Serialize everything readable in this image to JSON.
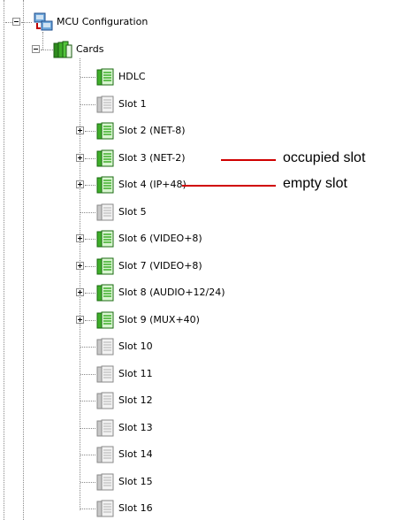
{
  "tree": {
    "root": {
      "label": "MCU Configuration",
      "icon": "network-config-icon"
    },
    "cards": {
      "label": "Cards",
      "icon": "cards-folder-icon"
    },
    "items": [
      {
        "label": "HDLC",
        "occupied": true,
        "expandable": false
      },
      {
        "label": "Slot 1",
        "occupied": false,
        "expandable": false
      },
      {
        "label": "Slot 2 (NET-8)",
        "occupied": true,
        "expandable": true
      },
      {
        "label": "Slot 3 (NET-2)",
        "occupied": true,
        "expandable": true
      },
      {
        "label": "Slot 4 (IP+48)",
        "occupied": true,
        "expandable": true
      },
      {
        "label": "Slot 5",
        "occupied": false,
        "expandable": false
      },
      {
        "label": "Slot 6 (VIDEO+8)",
        "occupied": true,
        "expandable": true
      },
      {
        "label": "Slot 7 (VIDEO+8)",
        "occupied": true,
        "expandable": true
      },
      {
        "label": "Slot 8 (AUDIO+12/24)",
        "occupied": true,
        "expandable": true
      },
      {
        "label": "Slot 9 (MUX+40)",
        "occupied": true,
        "expandable": true
      },
      {
        "label": "Slot 10",
        "occupied": false,
        "expandable": false
      },
      {
        "label": "Slot 11",
        "occupied": false,
        "expandable": false
      },
      {
        "label": "Slot 12",
        "occupied": false,
        "expandable": false
      },
      {
        "label": "Slot 13",
        "occupied": false,
        "expandable": false
      },
      {
        "label": "Slot 14",
        "occupied": false,
        "expandable": false
      },
      {
        "label": "Slot 15",
        "occupied": false,
        "expandable": false
      },
      {
        "label": "Slot 16",
        "occupied": false,
        "expandable": false
      }
    ]
  },
  "annotations": {
    "occupied": "occupied slot",
    "empty": "empty slot"
  },
  "colors": {
    "annotation_line": "#d00000",
    "occupied_card": "#3fae2a",
    "empty_card": "#c8c8c8"
  }
}
